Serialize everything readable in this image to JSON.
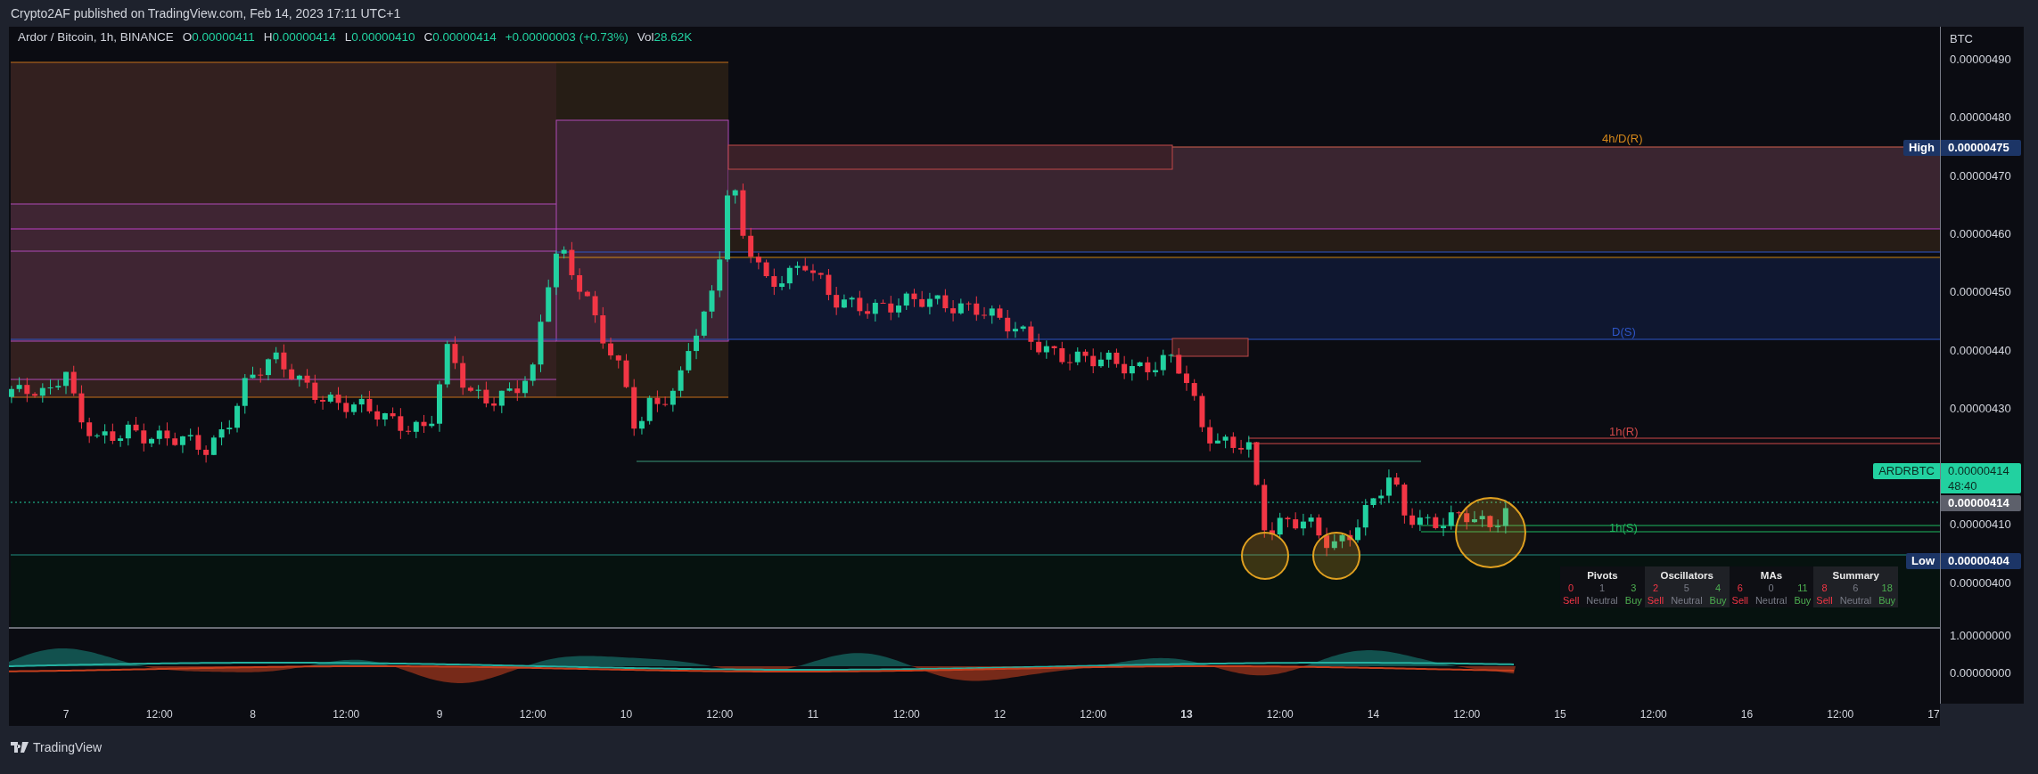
{
  "publish_line": "Crypto2AF published on TradingView.com, Feb 14, 2023 17:11 UTC+1",
  "legend": {
    "symbol": "Ardor / Bitcoin, 1h, BINANCE",
    "ohlc": [
      {
        "label": "O",
        "value": "0.00000411"
      },
      {
        "label": "H",
        "value": "0.00000414"
      },
      {
        "label": "L",
        "value": "0.00000410"
      },
      {
        "label": "C",
        "value": "0.00000414"
      }
    ],
    "change": "+0.00000003 (+0.73%)",
    "volume": {
      "label": "Vol",
      "value": "28.62K"
    }
  },
  "level_labels": [
    {
      "text": "4h/D(R)",
      "color": "#d4871a"
    },
    {
      "text": "D(S)",
      "color": "#2e56c8"
    },
    {
      "text": "1h(R)",
      "color": "#d04848"
    },
    {
      "text": "1h(S)",
      "color": "#1fb85e"
    }
  ],
  "signals": [
    {
      "title": "Pivots",
      "sell": "0",
      "neutral": "1",
      "buy": "3",
      "sell_label": "Sell",
      "neutral_label": "Neutral",
      "buy_label": "Buy"
    },
    {
      "title": "Oscillators",
      "sell": "2",
      "neutral": "5",
      "buy": "4",
      "sell_label": "Sell",
      "neutral_label": "Neutral",
      "buy_label": "Buy"
    },
    {
      "title": "MAs",
      "sell": "6",
      "neutral": "0",
      "buy": "11",
      "sell_label": "Sell",
      "neutral_label": "Neutral",
      "buy_label": "Buy"
    },
    {
      "title": "Summary",
      "sell": "8",
      "neutral": "6",
      "buy": "18",
      "sell_label": "Sell",
      "neutral_label": "Neutral",
      "buy_label": "Buy"
    }
  ],
  "price_axis": {
    "unit": "BTC",
    "ticks": [
      "0.00000490",
      "0.00000480",
      "0.00000470",
      "0.00000460",
      "0.00000450",
      "0.00000440",
      "0.00000430",
      "0.00000410",
      "0.00000400"
    ],
    "high": {
      "label": "High",
      "value": "0.00000475"
    },
    "low": {
      "label": "Low",
      "value": "0.00000404"
    },
    "symbol_tag": "ARDRBTC",
    "last_price": {
      "value": "0.00000414",
      "countdown": "48:40"
    },
    "prev_close": "0.00000414"
  },
  "oscillator_axis": [
    "1.00000000",
    "0.00000000"
  ],
  "time_axis": [
    {
      "text": "7",
      "bold": false
    },
    {
      "text": "12:00",
      "bold": false
    },
    {
      "text": "8",
      "bold": false
    },
    {
      "text": "12:00",
      "bold": false
    },
    {
      "text": "9",
      "bold": false
    },
    {
      "text": "12:00",
      "bold": false
    },
    {
      "text": "10",
      "bold": false
    },
    {
      "text": "12:00",
      "bold": false
    },
    {
      "text": "11",
      "bold": false
    },
    {
      "text": "12:00",
      "bold": false
    },
    {
      "text": "12",
      "bold": false
    },
    {
      "text": "12:00",
      "bold": false
    },
    {
      "text": "13",
      "bold": true
    },
    {
      "text": "12:00",
      "bold": false
    },
    {
      "text": "14",
      "bold": false
    },
    {
      "text": "12:00",
      "bold": false
    },
    {
      "text": "15",
      "bold": false
    },
    {
      "text": "12:00",
      "bold": false
    },
    {
      "text": "16",
      "bold": false
    },
    {
      "text": "12:00",
      "bold": false
    },
    {
      "text": "17",
      "bold": false
    }
  ],
  "brand": "TradingView"
}
